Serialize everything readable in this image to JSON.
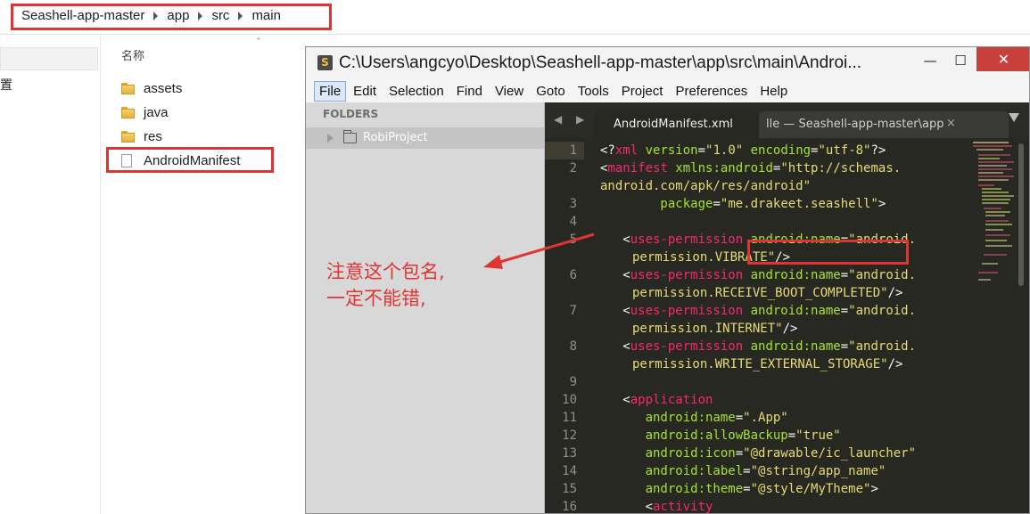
{
  "explorer": {
    "breadcrumb": [
      "Seashell-app-master",
      "app",
      "src",
      "main"
    ],
    "column_name": "名称",
    "nav_partial_text": "置",
    "files": [
      {
        "name": "assets",
        "type": "folder"
      },
      {
        "name": "java",
        "type": "folder"
      },
      {
        "name": "res",
        "type": "folder"
      },
      {
        "name": "AndroidManifest",
        "type": "file"
      }
    ]
  },
  "annotation": {
    "line1": "注意这个包名,",
    "line2": "一定不能错,",
    "color": "#e03434"
  },
  "sublime": {
    "title": "C:\\Users\\angcyo\\Desktop\\Seashell-app-master\\app\\src\\main\\Androi...",
    "window_buttons": {
      "minimize": "—",
      "maximize": "☐",
      "close": "✕"
    },
    "menu": [
      "File",
      "Edit",
      "Selection",
      "Find",
      "View",
      "Goto",
      "Tools",
      "Project",
      "Preferences",
      "Help"
    ],
    "sidebar": {
      "header": "FOLDERS",
      "project": "RobiProject"
    },
    "tabs": {
      "active": "AndroidManifest.xml",
      "inactive": "lle — Seashell-app-master\\app",
      "close_glyph": "×",
      "nav_arrows": "◀ ▶"
    },
    "line_numbers": [
      "1",
      "2",
      "3",
      "4",
      "5",
      "6",
      "7",
      "8",
      "9",
      "10",
      "11",
      "12",
      "13",
      "14",
      "15",
      "16"
    ],
    "code": {
      "l1a": "<?",
      "l1b": "xml",
      "l1c": " version",
      "l1d": "=",
      "l1e": "\"1.0\"",
      "l1f": " encoding",
      "l1g": "=",
      "l1h": "\"utf-8\"",
      "l1i": "?>",
      "l2a": "<",
      "l2b": "manifest",
      "l2c": " xmlns:android",
      "l2d": "=",
      "l2e": "\"http://schemas.",
      "l2w": "android.com/apk/res/android\"",
      "l3a": "        package",
      "l3b": "=",
      "l3c": "\"",
      "l3d": "me.drakeet.seashell",
      "l3e": "\"",
      "l3f": ">",
      "l5a": "   <",
      "l5b": "uses-permission",
      "l5c": " android:name",
      "l5d": "=",
      "l5e": "\"android.",
      "l5w": "permission.VIBRATE\"",
      "l5x": "/>",
      "l6a": "   <",
      "l6b": "uses-permission",
      "l6c": " android:name",
      "l6d": "=",
      "l6e": "\"android.",
      "l6w": "permission.RECEIVE_BOOT_COMPLETED\"",
      "l6x": "/>",
      "l7a": "   <",
      "l7b": "uses-permission",
      "l7c": " android:name",
      "l7d": "=",
      "l7e": "\"android.",
      "l7w": "permission.INTERNET\"",
      "l7x": "/>",
      "l8a": "   <",
      "l8b": "uses-permission",
      "l8c": " android:name",
      "l8d": "=",
      "l8e": "\"android.",
      "l8w": "permission.WRITE_EXTERNAL_STORAGE\"",
      "l8x": "/>",
      "l10a": "   <",
      "l10b": "application",
      "l11a": "      android:name",
      "l11b": "=",
      "l11c": "\".App\"",
      "l12a": "      android:allowBackup",
      "l12b": "=",
      "l12c": "\"true\"",
      "l13a": "      android:icon",
      "l13b": "=",
      "l13c": "\"@drawable/ic_launcher\"",
      "l14a": "      android:label",
      "l14b": "=",
      "l14c": "\"@string/app_name\"",
      "l15a": "      android:theme",
      "l15b": "=",
      "l15c": "\"@style/MyTheme\"",
      "l15d": ">",
      "l16a": "      <",
      "l16b": "activity"
    },
    "colors": {
      "tag": "#f92672",
      "attr": "#a6e22e",
      "string": "#e6db74",
      "bg": "#272822",
      "highlight": "#e03434"
    }
  }
}
